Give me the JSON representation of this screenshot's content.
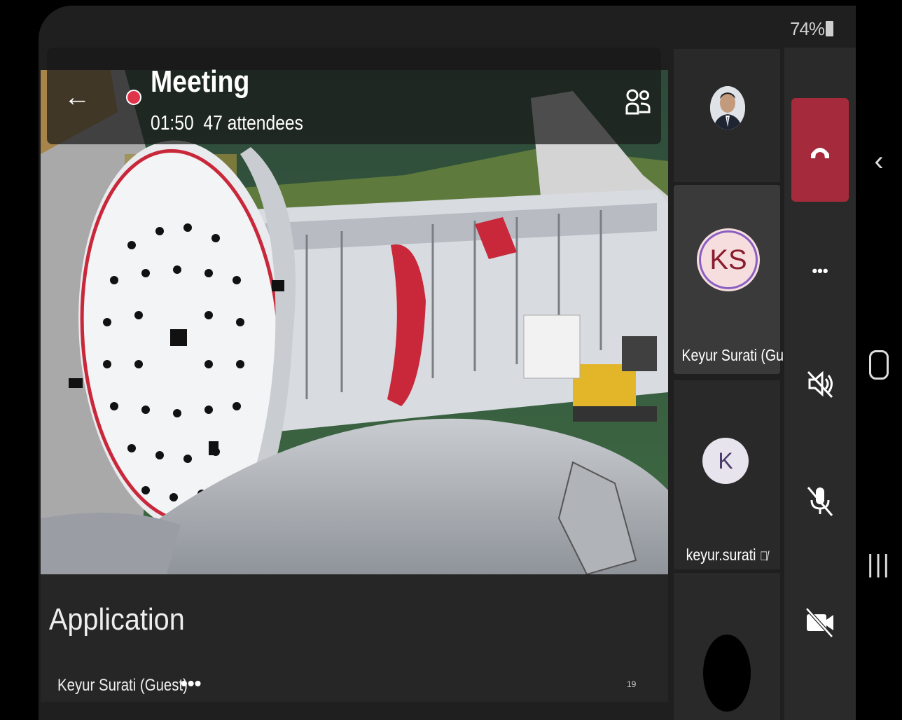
{
  "status": {
    "battery": "74%"
  },
  "meeting": {
    "title": "Meeting",
    "duration": "01:50",
    "attendees": "47 attendees"
  },
  "content": {
    "title": "Application",
    "presenter": "Keyur Surati (Guest)",
    "more": "•••",
    "page_number": "19"
  },
  "participants": [
    {
      "name": "",
      "avatar": "photo"
    },
    {
      "name": "Keyur Surati (Gu...",
      "initials": "KS"
    },
    {
      "name": "keyur.surati",
      "initials": "K",
      "muted": true
    },
    {
      "name": "",
      "avatar": "dark"
    }
  ],
  "controls": {
    "more": "•••",
    "icons": [
      "hang-up-icon",
      "more-icon",
      "speaker-off-icon",
      "mic-off-icon",
      "camera-off-icon"
    ]
  },
  "colors": {
    "hangup": "#a52a3c",
    "recording": "#e0344a",
    "ks_avatar_bg": "#f7dede",
    "ks_ring": "#8a5fc2"
  }
}
